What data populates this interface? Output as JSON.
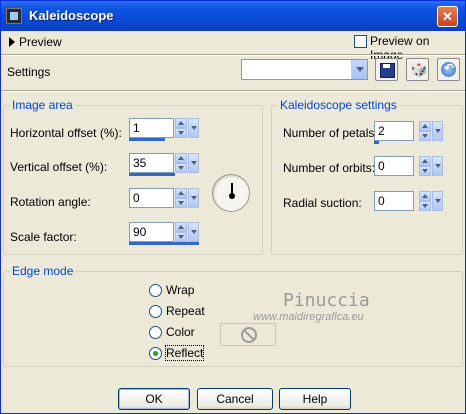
{
  "window": {
    "title": "Kaleidoscope",
    "close_glyph": "✕"
  },
  "preview": {
    "label": "Preview",
    "preview_on_image_label": "Preview on Image",
    "preview_on_image_checked": false
  },
  "settings": {
    "label": "Settings",
    "preset_value": ""
  },
  "toolbar": {
    "random_glyph": "🎲",
    "reset_glyph": "↶"
  },
  "image_area": {
    "title": "Image area",
    "horizontal_offset": {
      "label": "Horizontal offset (%):",
      "value": "1"
    },
    "vertical_offset": {
      "label": "Vertical offset (%):",
      "value": "35"
    },
    "rotation_angle": {
      "label": "Rotation angle:",
      "value": "0"
    },
    "scale_factor": {
      "label": "Scale factor:",
      "value": "90"
    }
  },
  "kaleidoscope_settings": {
    "title": "Kaleidoscope settings",
    "petals": {
      "label": "Number of petals:",
      "value": "2"
    },
    "orbits": {
      "label": "Number of orbits:",
      "value": "0"
    },
    "radial_suction": {
      "label": "Radial suction:",
      "value": "0"
    }
  },
  "edge_mode": {
    "title": "Edge mode",
    "options": [
      "Wrap",
      "Repeat",
      "Color",
      "Reflect"
    ],
    "selected": "Reflect"
  },
  "watermark": {
    "name": "Pinuccia",
    "url": "www.maidiregrafica.eu"
  },
  "buttons": {
    "ok": "OK",
    "cancel": "Cancel",
    "help": "Help"
  }
}
